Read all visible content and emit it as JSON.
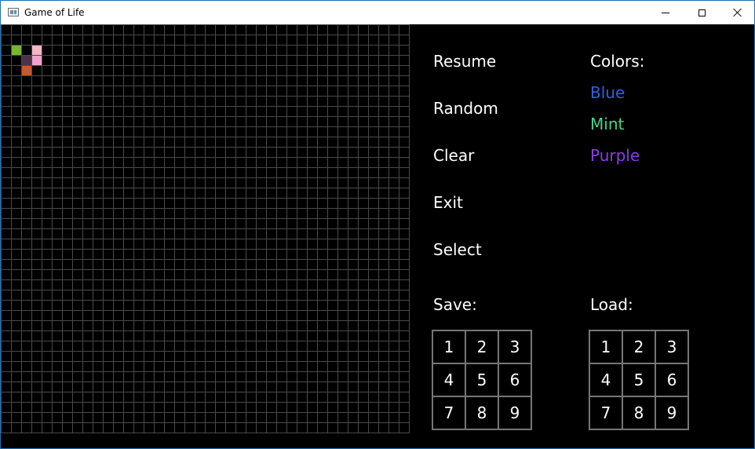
{
  "window": {
    "title": "Game of Life"
  },
  "board": {
    "grid_size": 40,
    "line_color": "#4a4a4a",
    "background": "#000000",
    "live_cells": [
      {
        "row": 2,
        "col": 1,
        "color": "#76b82a"
      },
      {
        "row": 2,
        "col": 3,
        "color": "#f4b6c2"
      },
      {
        "row": 3,
        "col": 2,
        "color": "#4a3248"
      },
      {
        "row": 3,
        "col": 3,
        "color": "#f5a0cf"
      },
      {
        "row": 4,
        "col": 2,
        "color": "#c55a2a"
      }
    ]
  },
  "menu": {
    "resume": "Resume",
    "random": "Random",
    "clear": "Clear",
    "exit": "Exit",
    "select": "Select"
  },
  "colors": {
    "heading": "Colors:",
    "options": [
      {
        "label": "Blue",
        "color": "#2e5fe6"
      },
      {
        "label": "Mint",
        "color": "#3ed98a"
      },
      {
        "label": "Purple",
        "color": "#8c3be8"
      }
    ]
  },
  "save": {
    "heading": "Save:",
    "slots": [
      "1",
      "2",
      "3",
      "4",
      "5",
      "6",
      "7",
      "8",
      "9"
    ]
  },
  "load": {
    "heading": "Load:",
    "slots": [
      "1",
      "2",
      "3",
      "4",
      "5",
      "6",
      "7",
      "8",
      "9"
    ]
  }
}
